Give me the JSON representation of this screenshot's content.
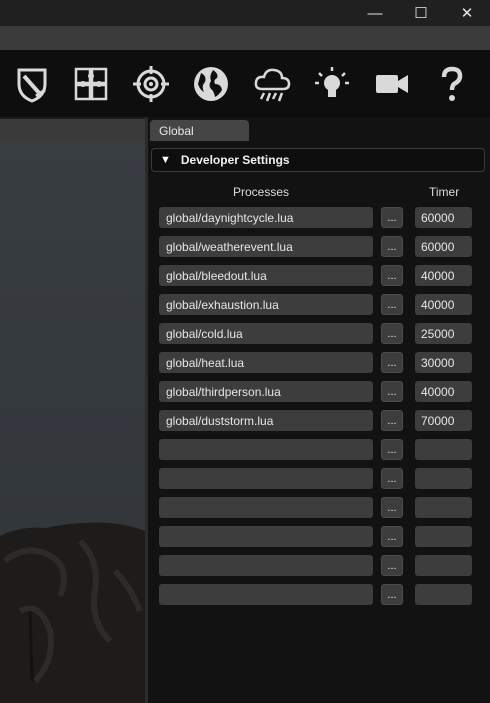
{
  "window": {
    "minimize_glyph": "—",
    "maximize_glyph": "☐",
    "close_glyph": "✕"
  },
  "toolbar": {
    "icons": [
      "shield-sword-icon",
      "puzzle-icon",
      "target-icon",
      "globe-icon",
      "rain-cloud-icon",
      "lightbulb-icon",
      "video-camera-icon",
      "help-icon"
    ]
  },
  "panel": {
    "tab_label": "Global",
    "section_title": "Developer Settings",
    "section_toggle": "▼",
    "columns": {
      "processes": "Processes",
      "timer": "Timer"
    },
    "browse_label": "...",
    "rows": [
      {
        "process": "global/daynightcycle.lua",
        "timer": "60000"
      },
      {
        "process": "global/weatherevent.lua",
        "timer": "60000"
      },
      {
        "process": "global/bleedout.lua",
        "timer": "40000"
      },
      {
        "process": "global/exhaustion.lua",
        "timer": "40000"
      },
      {
        "process": "global/cold.lua",
        "timer": "25000"
      },
      {
        "process": "global/heat.lua",
        "timer": "30000"
      },
      {
        "process": "global/thirdperson.lua",
        "timer": "40000"
      },
      {
        "process": "global/duststorm.lua",
        "timer": "70000"
      },
      {
        "process": "",
        "timer": ""
      },
      {
        "process": "",
        "timer": ""
      },
      {
        "process": "",
        "timer": ""
      },
      {
        "process": "",
        "timer": ""
      },
      {
        "process": "",
        "timer": ""
      },
      {
        "process": "",
        "timer": ""
      }
    ]
  },
  "colors": {
    "panel_bg": "#121212",
    "field_bg": "#3d3d3d",
    "toolbar_bg": "#0e0e0e",
    "icon": "#d9d9d9"
  }
}
